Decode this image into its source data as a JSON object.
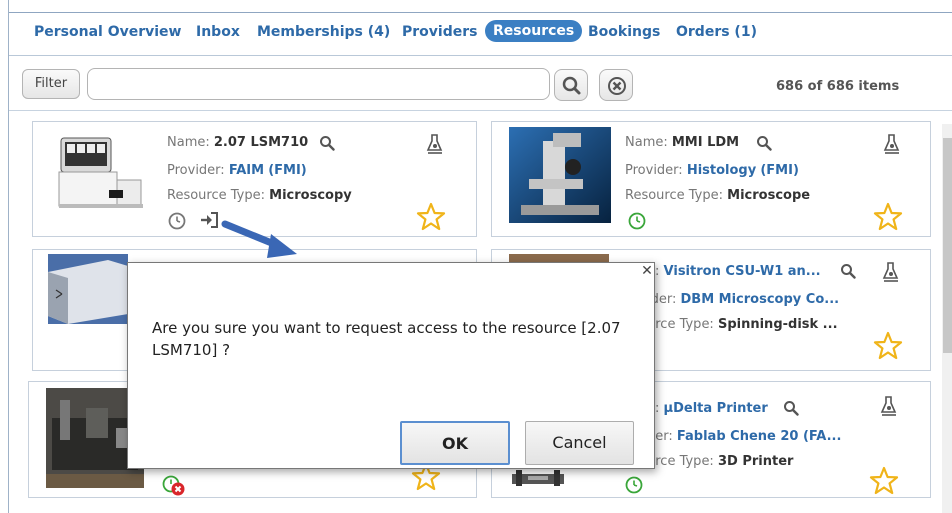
{
  "nav": {
    "items": [
      "Personal Overview",
      "Inbox",
      "Memberships (4)",
      "Providers",
      "Resources",
      "Bookings",
      "Orders (1)"
    ],
    "active": "Resources"
  },
  "filter": {
    "button_label": "Filter",
    "search_value": "",
    "count_text": "686 of 686 items"
  },
  "resources": [
    {
      "name_label": "Name:",
      "name": "2.07 LSM710",
      "provider_label": "Provider:",
      "provider": "FAIM",
      "provider_paren": "(FMI)",
      "type_label": "Resource Type:",
      "type": "Microscopy"
    },
    {
      "name_label": "Name:",
      "name": "MMI LDM",
      "provider_label": "Provider:",
      "provider": "Histology",
      "provider_paren": "(FMI)",
      "type_label": "Resource Type:",
      "type": "Microscope"
    },
    {
      "name_label": "e:",
      "name": "Visitron CSU-W1 an...",
      "provider_label": "ider:",
      "provider": "DBM Microscopy Co...",
      "provider_paren": "",
      "type_label": "urce Type:",
      "type": "Spinning-disk ..."
    },
    {
      "name_label": "e:",
      "name": "µDelta Printer",
      "provider_label": "der:",
      "provider": "Fablab Chene 20 (FA...",
      "provider_paren": "",
      "type_label": "urce Type:",
      "type": "3D Printer"
    }
  ],
  "dialog": {
    "message": "Are you sure you want to request access to the resource [2.07 LSM710] ?",
    "ok_label": "OK",
    "cancel_label": "Cancel",
    "close_glyph": "✕"
  },
  "colors": {
    "accent": "#3b7fc3",
    "link": "#2e6aa8",
    "star": "#f0b419",
    "clock_green": "#3aa63a",
    "clock_gray": "#777777",
    "error_red": "#d9262b"
  }
}
